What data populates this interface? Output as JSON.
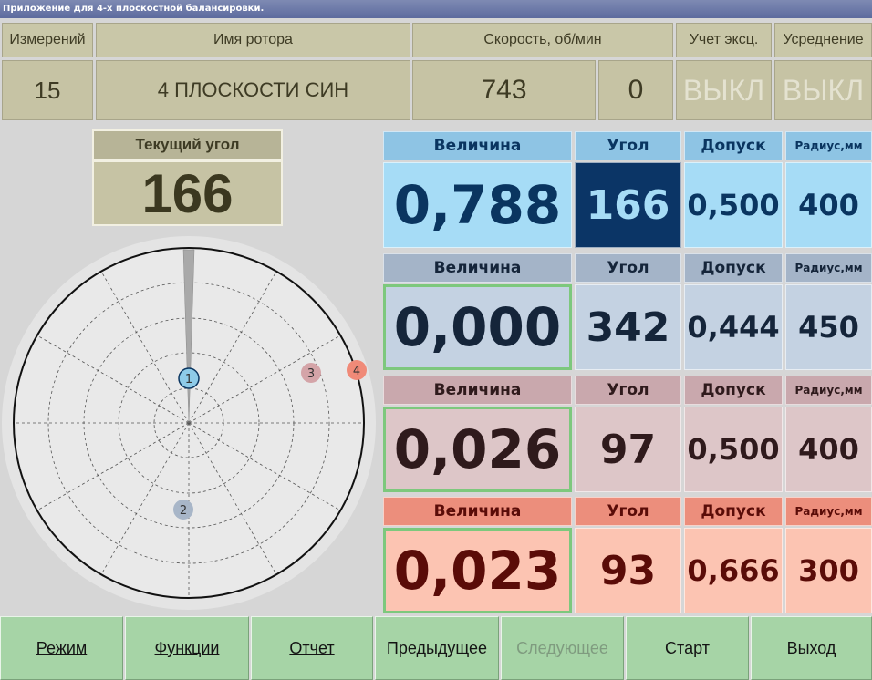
{
  "window": {
    "title": "Приложение для 4-х плоскостной балансировки."
  },
  "header": {
    "measurements_label": "Измерений",
    "rotor_name_label": "Имя ротора",
    "speed_label": "Скорость, об/мин",
    "ecc_label": "Учет эксц.",
    "averaging_label": "Усреднение",
    "measurements_value": "15",
    "rotor_name_value": "4 ПЛОСКОСТИ СИН",
    "speed_value": "743",
    "speed_value_2": "0",
    "ecc_value": "ВЫКЛ",
    "averaging_value": "ВЫКЛ"
  },
  "current_angle": {
    "label": "Текущий угол",
    "value": "166"
  },
  "planes": [
    {
      "magnitude_label": "Величина",
      "angle_label": "Угол",
      "tolerance_label": "Допуск",
      "radius_label": "Радиус,мм",
      "magnitude": "0,788",
      "angle": "166",
      "tolerance": "0,500",
      "radius": "400",
      "colors": {
        "header": "#8ec4e4",
        "value": "#a6dcf6",
        "text": "#0a3560",
        "angle_bg": "#0b3566",
        "angle_text": "#a6dcf6"
      }
    },
    {
      "magnitude_label": "Величина",
      "angle_label": "Угол",
      "tolerance_label": "Допуск",
      "radius_label": "Радиус,мм",
      "magnitude": "0,000",
      "angle": "342",
      "tolerance": "0,444",
      "radius": "450",
      "colors": {
        "header": "#a4b4c8",
        "value": "#c4d2e2",
        "text": "#15253a"
      }
    },
    {
      "magnitude_label": "Величина",
      "angle_label": "Угол",
      "tolerance_label": "Допуск",
      "radius_label": "Радиус,мм",
      "magnitude": "0,026",
      "angle": "97",
      "tolerance": "0,500",
      "radius": "400",
      "colors": {
        "header": "#c9a8ad",
        "value": "#ddc6c8",
        "text": "#2f1a1c"
      }
    },
    {
      "magnitude_label": "Величина",
      "angle_label": "Угол",
      "tolerance_label": "Допуск",
      "radius_label": "Радиус,мм",
      "magnitude": "0,023",
      "angle": "93",
      "tolerance": "0,666",
      "radius": "300",
      "colors": {
        "header": "#ec8e7c",
        "value": "#fcc4b2",
        "text": "#5a0c08"
      }
    }
  ],
  "polar": {
    "pointer_angle_deg": 166,
    "markers": [
      {
        "label": "1",
        "color": "#8ecbe8"
      },
      {
        "label": "2",
        "color": "#a8b6c8"
      },
      {
        "label": "3",
        "color": "#d4a4a8"
      },
      {
        "label": "4",
        "color": "#f08a78"
      }
    ]
  },
  "buttons": {
    "mode": "Режим",
    "functions": "Функции",
    "report": "Отчет",
    "previous": "Предыдущее",
    "next": "Следующее",
    "start": "Старт",
    "exit": "Выход"
  }
}
